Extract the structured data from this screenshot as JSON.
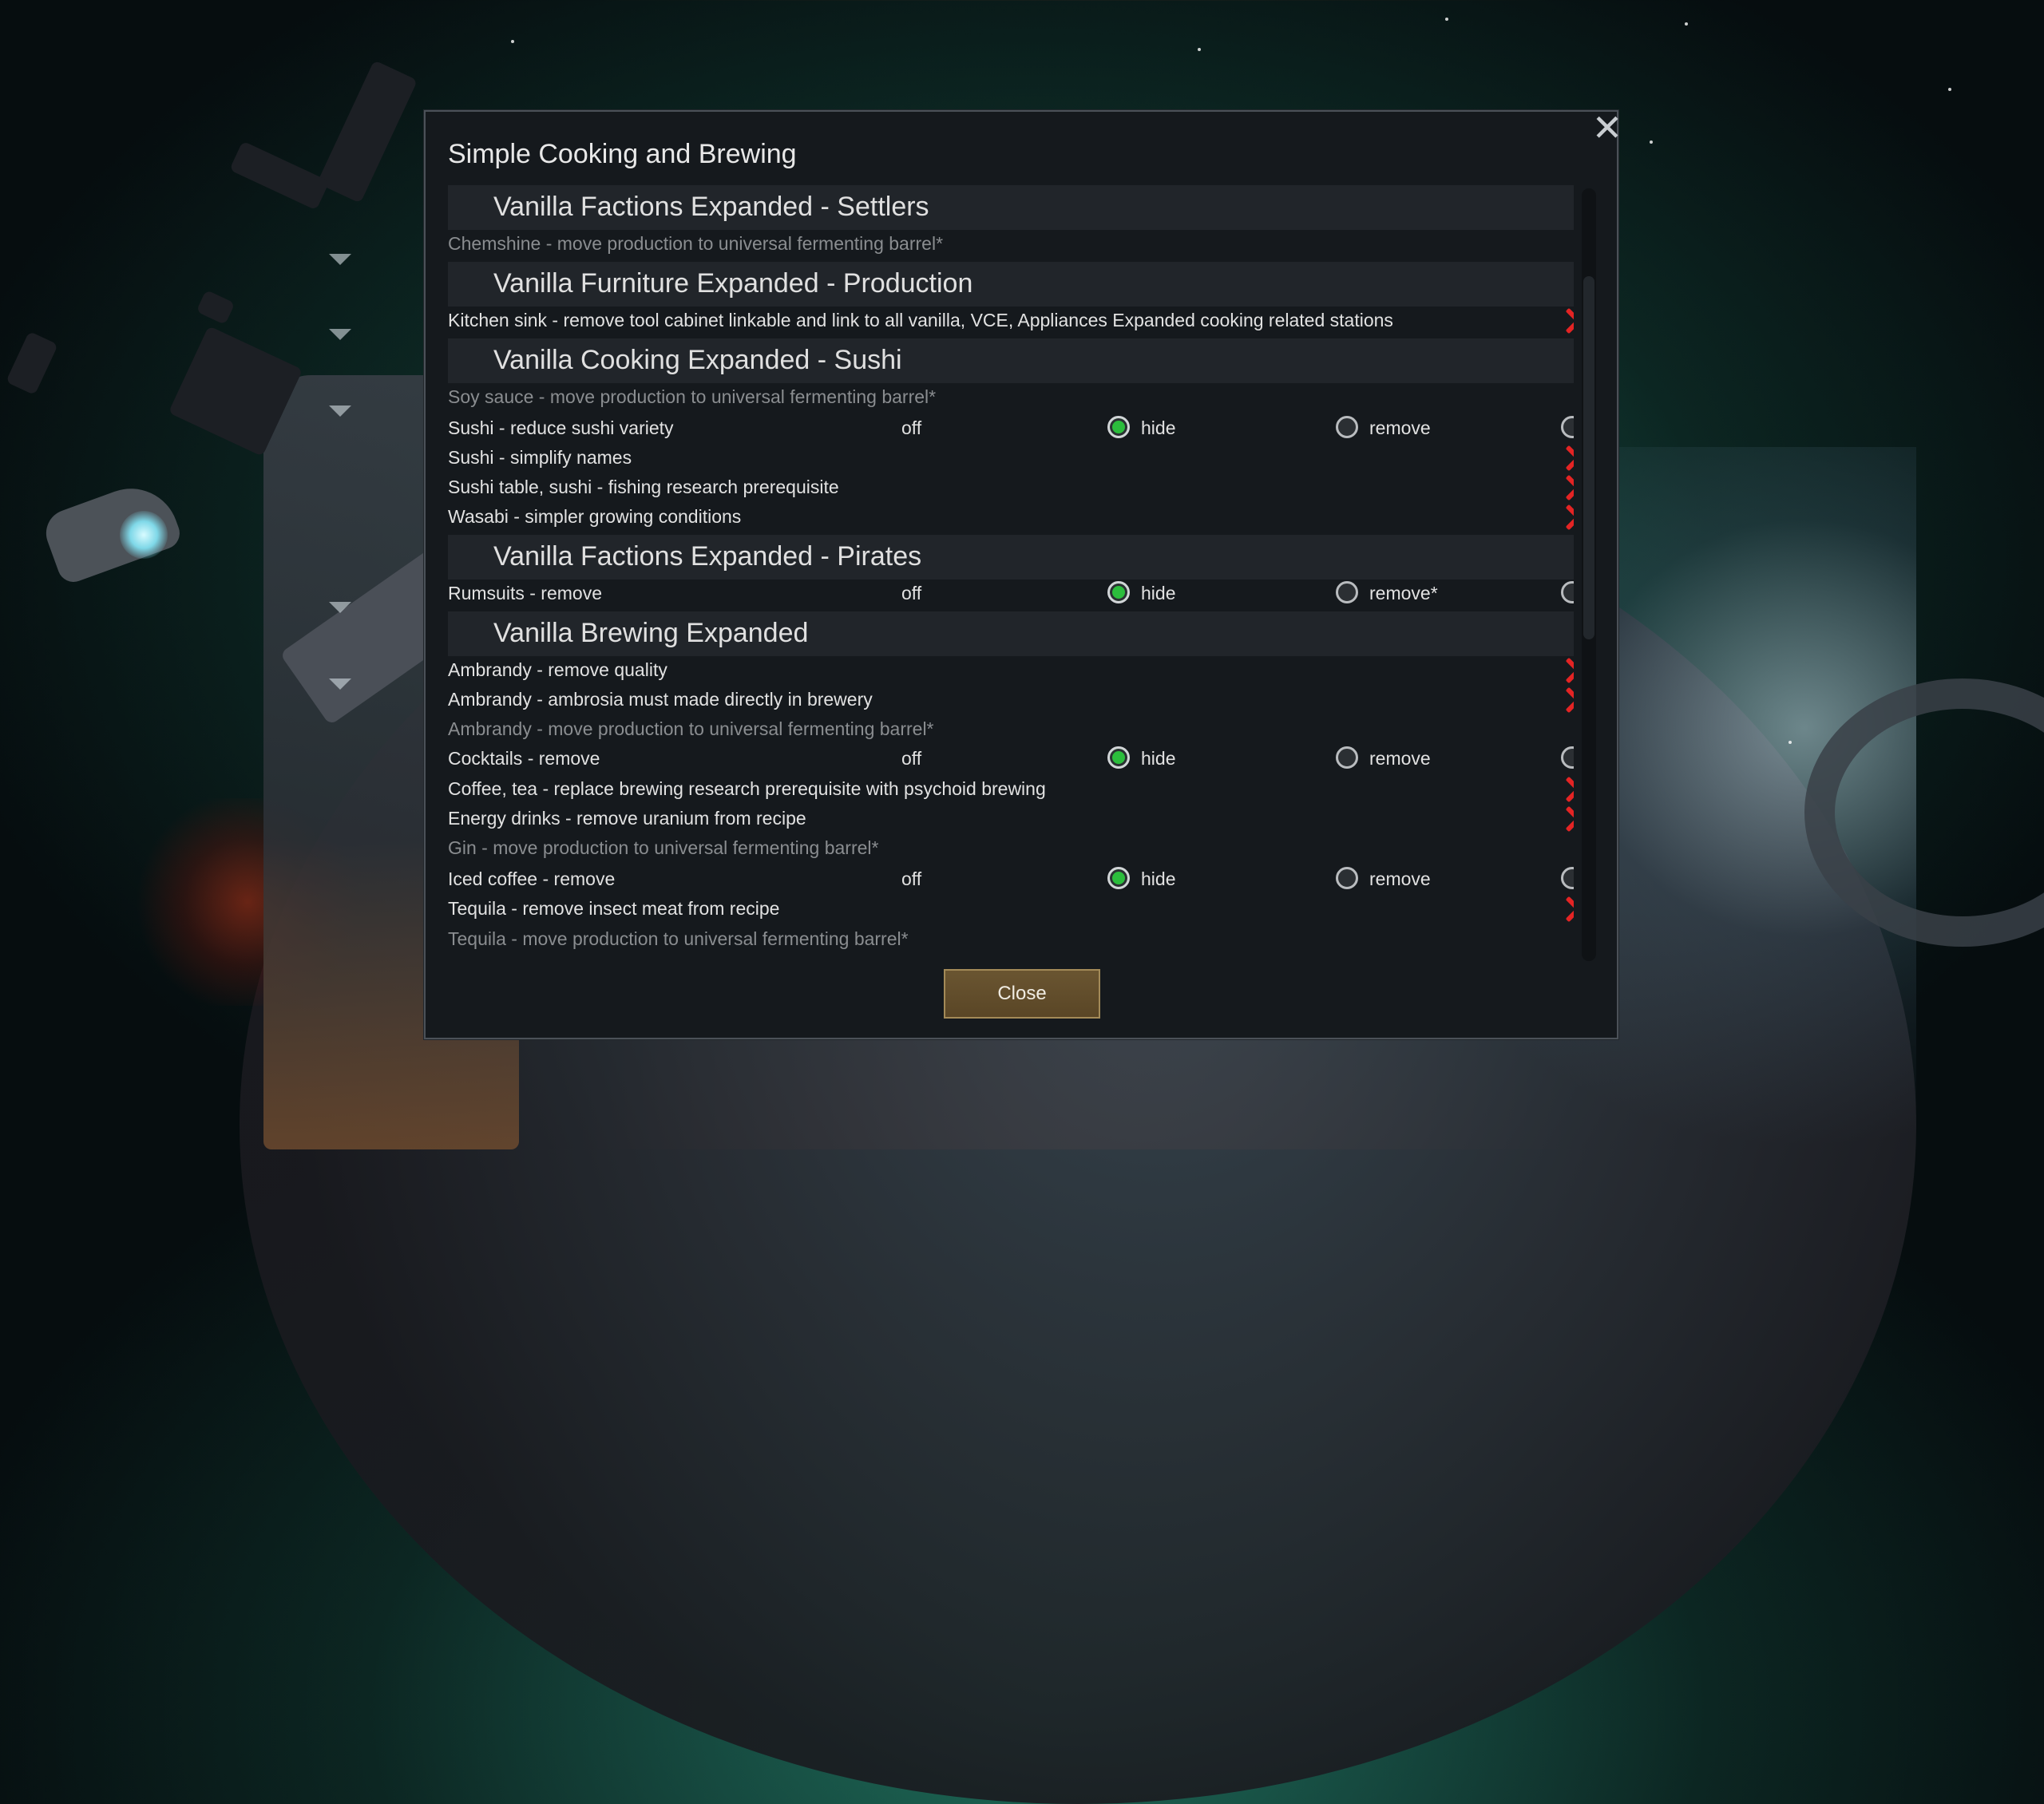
{
  "dialog": {
    "title": "Simple Cooking and Brewing",
    "close_icon": "close-icon",
    "close_button_label": "Close"
  },
  "options": {
    "off": "off",
    "hide": "hide",
    "remove": "remove",
    "remove_star": "remove*"
  },
  "sections": [
    {
      "title": "Vanilla Factions Expanded - Settlers"
    },
    {
      "title": "Vanilla Furniture Expanded - Production"
    },
    {
      "title": "Vanilla Cooking Expanded - Sushi"
    },
    {
      "title": "Vanilla Factions Expanded - Pirates"
    },
    {
      "title": "Vanilla Brewing Expanded"
    }
  ],
  "rows": [
    {
      "label": "Chemshine - move production to universal fermenting barrel*",
      "kind": "disabled"
    },
    {
      "label": "Kitchen sink - remove tool cabinet linkable and link to all vanilla, VCE, Appliances Expanded cooking related stations",
      "kind": "toggle",
      "enabled": false
    },
    {
      "label": "Soy sauce - move production to universal fermenting barrel*",
      "kind": "disabled"
    },
    {
      "label": "Sushi - reduce sushi variety",
      "kind": "radio",
      "selected": "hide"
    },
    {
      "label": "Sushi - simplify names",
      "kind": "toggle",
      "enabled": false
    },
    {
      "label": "Sushi table, sushi - fishing research prerequisite",
      "kind": "toggle",
      "enabled": false
    },
    {
      "label": "Wasabi - simpler growing conditions",
      "kind": "toggle",
      "enabled": false
    },
    {
      "label": "Rumsuits - remove",
      "kind": "radio",
      "selected": "hide"
    },
    {
      "label": "Ambrandy - remove quality",
      "kind": "toggle",
      "enabled": false
    },
    {
      "label": "Ambrandy - ambrosia must made directly in brewery",
      "kind": "toggle",
      "enabled": false
    },
    {
      "label": "Ambrandy - move production to universal fermenting barrel*",
      "kind": "disabled"
    },
    {
      "label": "Cocktails - remove",
      "kind": "radio",
      "selected": "hide"
    },
    {
      "label": "Coffee, tea - replace brewing research prerequisite with psychoid brewing",
      "kind": "toggle",
      "enabled": false
    },
    {
      "label": "Energy drinks - remove uranium from recipe",
      "kind": "toggle",
      "enabled": false
    },
    {
      "label": "Gin - move production to universal fermenting barrel*",
      "kind": "disabled"
    },
    {
      "label": "Iced coffee - remove",
      "kind": "radio",
      "selected": "hide"
    },
    {
      "label": "Tequila - remove insect meat from recipe",
      "kind": "toggle",
      "enabled": false
    },
    {
      "label": "Tequila - move production to universal fermenting barrel*",
      "kind": "disabled"
    }
  ],
  "colors": {
    "dialog_bg": "#15191d",
    "section_bg": "#21252a",
    "radio_selected": "#2bbd3c",
    "toggle_off": "#e42424",
    "button_bg": "#6a5531"
  }
}
